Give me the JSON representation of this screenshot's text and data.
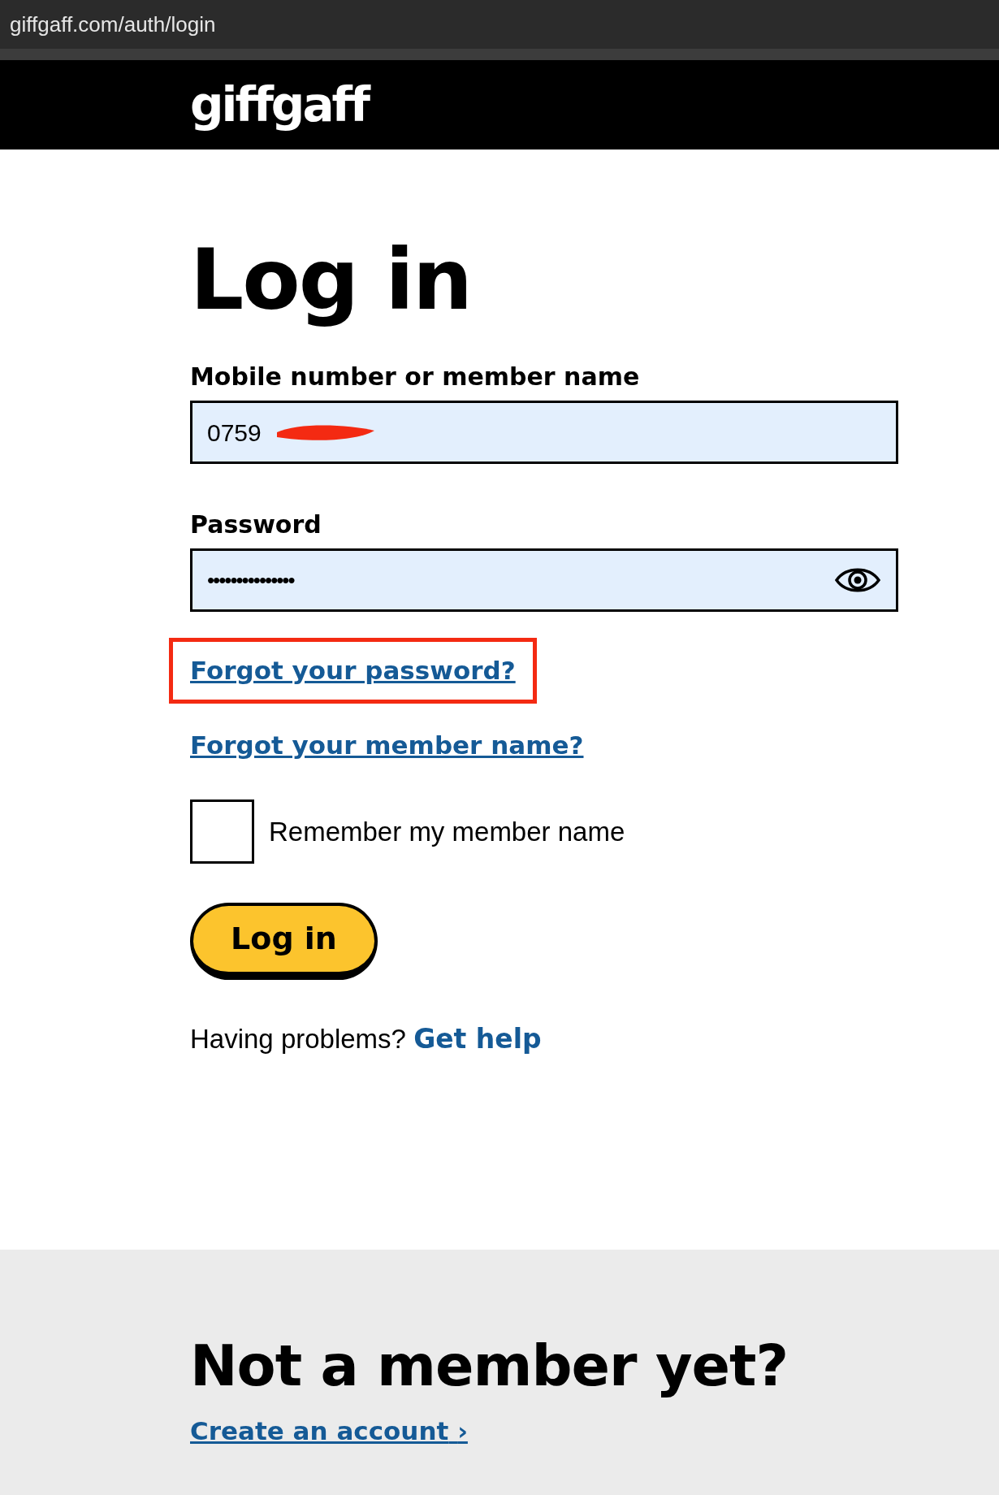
{
  "browser": {
    "url": "giffgaff.com/auth/login"
  },
  "header": {
    "logo": "giffgaff"
  },
  "title": "Log in",
  "fields": [
    {
      "kind": "text",
      "label": "Mobile number or member name",
      "value": "0759",
      "redacted": true
    },
    {
      "kind": "password",
      "label": "Password",
      "value": "•••••••••••••••",
      "redacted": false
    }
  ],
  "links": [
    {
      "label": "Forgot your password?",
      "highlighted": true
    },
    {
      "label": "Forgot your member name?",
      "highlighted": false
    }
  ],
  "remember": {
    "label": "Remember my member name",
    "checked": false
  },
  "submit": "Log in",
  "help": {
    "text": "Having problems?",
    "link": "Get help"
  },
  "footer": {
    "title": "Not a member yet?",
    "link": "Create an account",
    "link_icon": "›"
  }
}
